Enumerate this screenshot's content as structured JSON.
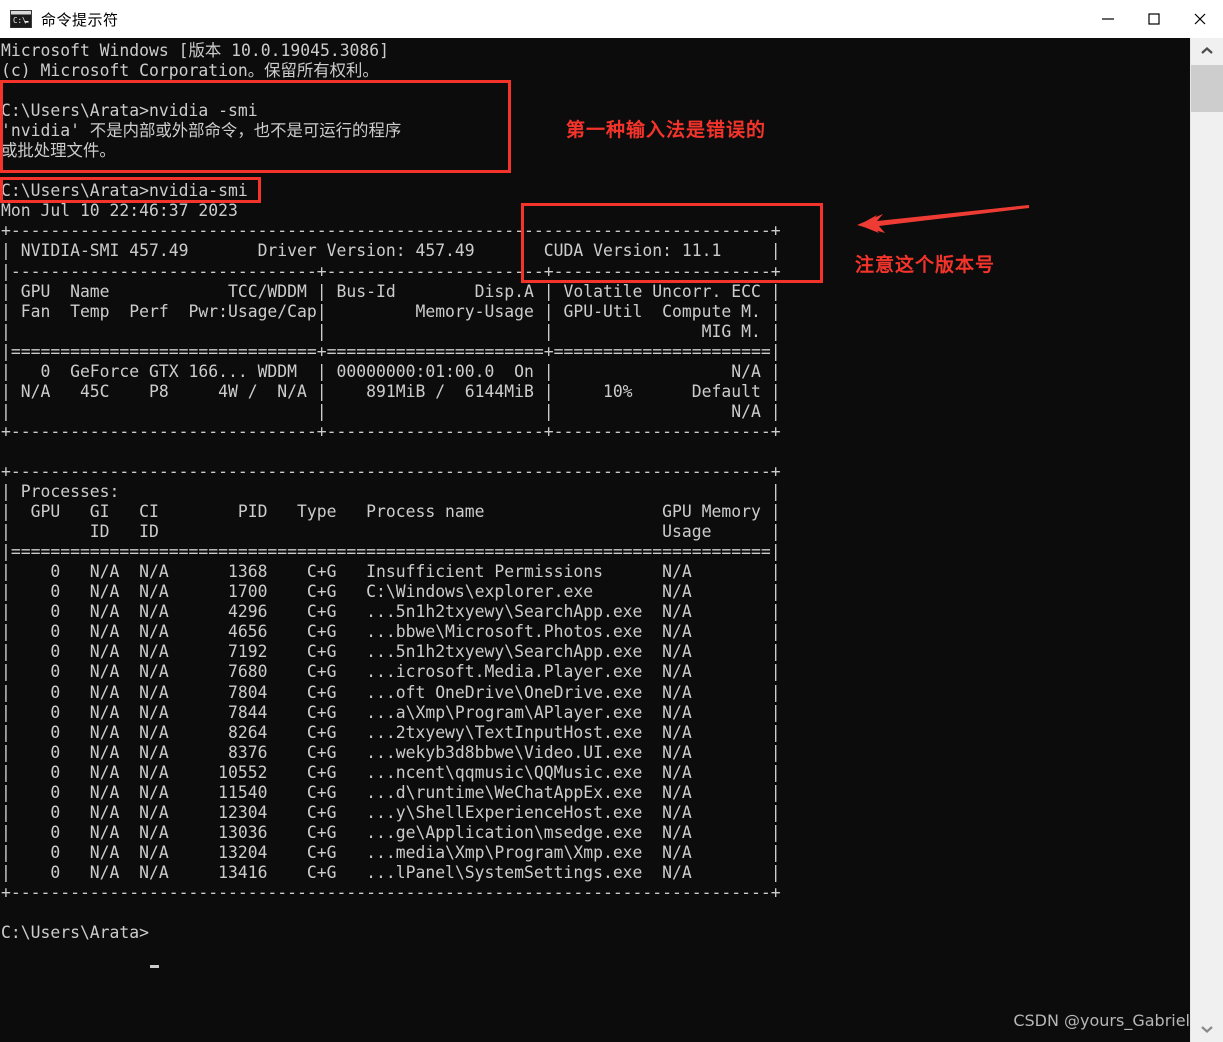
{
  "window": {
    "title": "命令提示符",
    "icon": "cmd-console-icon",
    "controls": {
      "minimize": "minimize-icon",
      "maximize": "maximize-icon",
      "close": "close-icon"
    }
  },
  "terminal": {
    "background_color": "#0c0c0c",
    "text_color": "#cccccc",
    "content": "Microsoft Windows [版本 10.0.19045.3086]\n(c) Microsoft Corporation。保留所有权利。\n\nC:\\Users\\Arata>nvidia -smi\n'nvidia' 不是内部或外部命令，也不是可运行的程序\n或批处理文件。\n\nC:\\Users\\Arata>nvidia-smi\nMon Jul 10 22:46:37 2023\n+-----------------------------------------------------------------------------+\n| NVIDIA-SMI 457.49       Driver Version: 457.49       CUDA Version: 11.1     |\n|-------------------------------+----------------------+----------------------+\n| GPU  Name            TCC/WDDM | Bus-Id        Disp.A | Volatile Uncorr. ECC |\n| Fan  Temp  Perf  Pwr:Usage/Cap|         Memory-Usage | GPU-Util  Compute M. |\n|                               |                      |               MIG M. |\n|===============================+======================+======================|\n|   0  GeForce GTX 166... WDDM  | 00000000:01:00.0  On |                  N/A |\n| N/A   45C    P8     4W /  N/A |    891MiB /  6144MiB |     10%      Default |\n|                               |                      |                  N/A |\n+-------------------------------+----------------------+----------------------+\n\n+-----------------------------------------------------------------------------+\n| Processes:                                                                  |\n|  GPU   GI   CI        PID   Type   Process name                  GPU Memory |\n|        ID   ID                                                   Usage      |\n|=============================================================================|\n|    0   N/A  N/A      1368    C+G   Insufficient Permissions      N/A        |\n|    0   N/A  N/A      1700    C+G   C:\\Windows\\explorer.exe       N/A        |\n|    0   N/A  N/A      4296    C+G   ...5n1h2txyewy\\SearchApp.exe  N/A        |\n|    0   N/A  N/A      4656    C+G   ...bbwe\\Microsoft.Photos.exe  N/A        |\n|    0   N/A  N/A      7192    C+G   ...5n1h2txyewy\\SearchApp.exe  N/A        |\n|    0   N/A  N/A      7680    C+G   ...icrosoft.Media.Player.exe  N/A        |\n|    0   N/A  N/A      7804    C+G   ...oft OneDrive\\OneDrive.exe  N/A        |\n|    0   N/A  N/A      7844    C+G   ...a\\Xmp\\Program\\APlayer.exe  N/A        |\n|    0   N/A  N/A      8264    C+G   ...2txyewy\\TextInputHost.exe  N/A        |\n|    0   N/A  N/A      8376    C+G   ...wekyb3d8bbwe\\Video.UI.exe  N/A        |\n|    0   N/A  N/A     10552    C+G   ...ncent\\qqmusic\\QQMusic.exe  N/A        |\n|    0   N/A  N/A     11540    C+G   ...d\\runtime\\WeChatAppEx.exe  N/A        |\n|    0   N/A  N/A     12304    C+G   ...y\\ShellExperienceHost.exe  N/A        |\n|    0   N/A  N/A     13036    C+G   ...ge\\Application\\msedge.exe  N/A        |\n|    0   N/A  N/A     13204    C+G   ...media\\Xmp\\Program\\Xmp.exe  N/A        |\n|    0   N/A  N/A     13416    C+G   ...lPanel\\SystemSettings.exe  N/A        |\n+-----------------------------------------------------------------------------+\n\nC:\\Users\\Arata>",
    "prompt_cursor": "block-cursor"
  },
  "annotations": {
    "color": "#f4342b",
    "box_wrong_command": {
      "label": "wrong-command-highlight-box"
    },
    "box_correct_command": {
      "label": "correct-command-highlight-box"
    },
    "box_cuda_version": {
      "label": "cuda-version-highlight-box"
    },
    "note_wrong_input": "第一种输入法是错误的",
    "note_cuda_version": "注意这个版本号",
    "arrow": "red-arrow-pointing-left"
  },
  "watermark": {
    "text": "CSDN @yours_Gabriel"
  },
  "scrollbar": {
    "up_arrow": "chevron-up-icon",
    "down_arrow": "chevron-down-icon",
    "thumb": "scrollbar-thumb"
  }
}
